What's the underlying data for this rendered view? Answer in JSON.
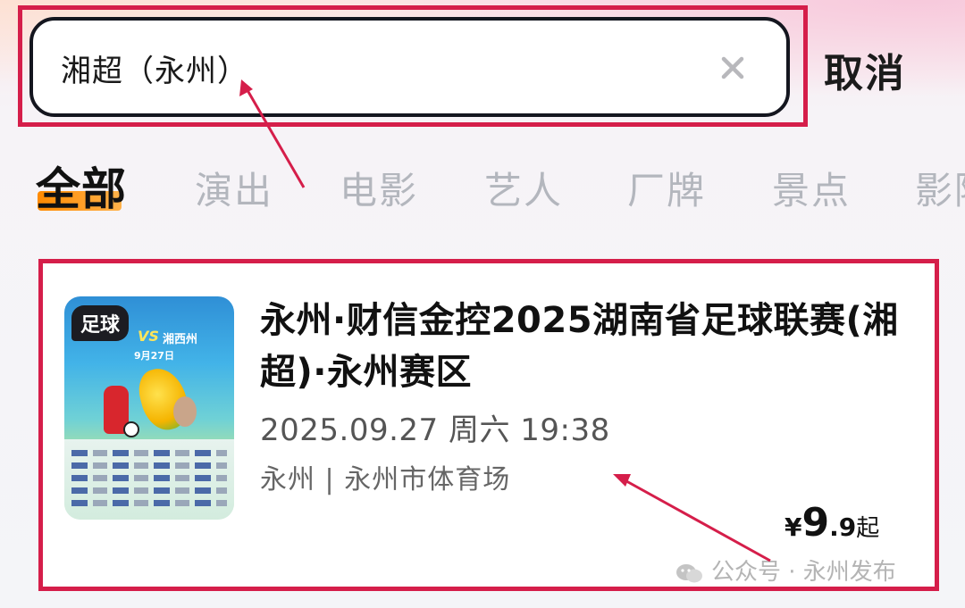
{
  "search": {
    "query": "湘超（永州）",
    "cancel_label": "取消"
  },
  "tabs": [
    {
      "label": "全部",
      "active": true
    },
    {
      "label": "演出"
    },
    {
      "label": "电影"
    },
    {
      "label": "艺人"
    },
    {
      "label": "厂牌"
    },
    {
      "label": "景点"
    },
    {
      "label": "影院"
    }
  ],
  "result": {
    "category_badge": "足球",
    "title": "永州·财信金控2025湖南省足球联赛(湘超)·永州赛区",
    "datetime": "2025.09.27 周六 19:38",
    "city": "永州",
    "venue": "永州市体育场",
    "price": {
      "currency": "¥",
      "integer": "9",
      "decimal": ".9",
      "suffix": "起"
    },
    "poster": {
      "vs_text": "VS",
      "opponent": "湘西州",
      "date": "9月27日"
    }
  },
  "watermark": "公众号 · 永州发布",
  "colors": {
    "highlight": "#d51e4a",
    "tab_active_underline": "#ff8a00",
    "tab_inactive": "#b3b6bd"
  }
}
